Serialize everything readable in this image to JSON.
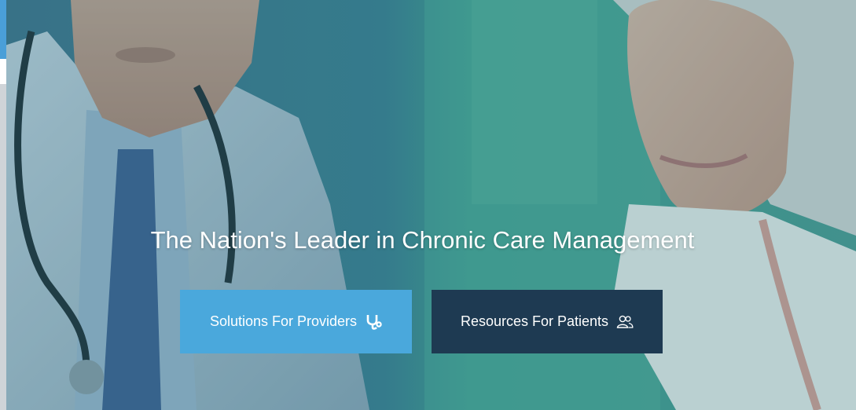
{
  "hero": {
    "headline": "The Nation's Leader in Chronic Care Management"
  },
  "buttons": [
    {
      "label": "Solutions For Providers",
      "icon": "stethoscope-icon",
      "color": "#4aa8dc"
    },
    {
      "label": "Resources For Patients",
      "icon": "people-icon",
      "color": "#1e3a52"
    }
  ],
  "colors": {
    "headline_text": "#ffffff",
    "overlay_teal": "#2f7a86"
  }
}
